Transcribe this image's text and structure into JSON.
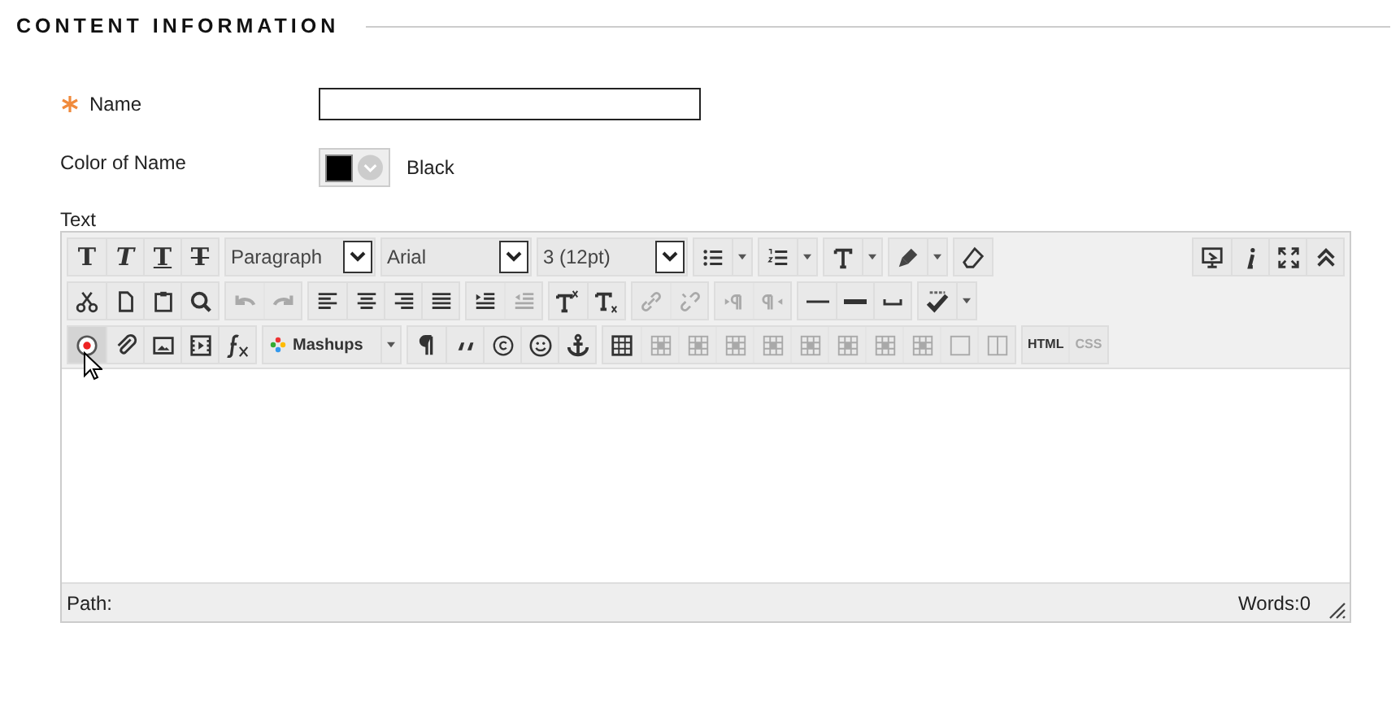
{
  "section": {
    "title": "CONTENT INFORMATION"
  },
  "fields": [
    {
      "kind": "text",
      "label": "Name",
      "required": true
    },
    {
      "kind": "color",
      "label": "Color of Name",
      "required": false,
      "color": "#000000",
      "value": "Black"
    }
  ],
  "editor": {
    "label": "Text",
    "toolbar": [
      [
        [
          {
            "kind": "bold",
            "label": "T",
            "disabled": false
          },
          {
            "kind": "italic",
            "label": "T",
            "disabled": false
          },
          {
            "kind": "underline",
            "label": "T",
            "disabled": false
          },
          {
            "kind": "strike",
            "label": "T",
            "disabled": false
          }
        ],
        [
          {
            "kind": "select",
            "value": "Paragraph"
          }
        ],
        [
          {
            "kind": "select",
            "value": "Arial"
          }
        ],
        [
          {
            "kind": "select",
            "value": "3 (12pt)"
          }
        ],
        [
          {
            "kind": "bullets",
            "split": true,
            "disabled": false
          }
        ],
        [
          {
            "kind": "numbers",
            "split": true,
            "disabled": false
          }
        ],
        [
          {
            "kind": "textcolor",
            "split": true,
            "disabled": false
          }
        ],
        [
          {
            "kind": "highlight",
            "split": true,
            "disabled": false
          }
        ],
        [
          {
            "kind": "eraser",
            "disabled": false
          }
        ],
        [
          {
            "kind": "spacer"
          }
        ],
        [
          {
            "kind": "preview",
            "disabled": false
          },
          {
            "kind": "info",
            "disabled": false
          },
          {
            "kind": "fullscreen",
            "disabled": false
          },
          {
            "kind": "collapse",
            "disabled": false
          }
        ]
      ],
      [
        [
          {
            "kind": "cut",
            "disabled": false
          },
          {
            "kind": "copy",
            "disabled": false
          },
          {
            "kind": "paste",
            "disabled": false
          },
          {
            "kind": "find",
            "disabled": false
          }
        ],
        [
          {
            "kind": "undo",
            "disabled": true
          },
          {
            "kind": "redo",
            "disabled": true
          }
        ],
        [
          {
            "kind": "alignleft",
            "disabled": false
          },
          {
            "kind": "aligncenter",
            "disabled": false
          },
          {
            "kind": "alignright",
            "disabled": false
          },
          {
            "kind": "justify",
            "disabled": false
          }
        ],
        [
          {
            "kind": "indent",
            "disabled": false
          },
          {
            "kind": "outdent",
            "disabled": true
          }
        ],
        [
          {
            "kind": "superscript",
            "disabled": false
          },
          {
            "kind": "subscript",
            "disabled": false
          }
        ],
        [
          {
            "kind": "link",
            "disabled": true
          },
          {
            "kind": "unlink",
            "disabled": true
          }
        ],
        [
          {
            "kind": "ltr",
            "disabled": true
          },
          {
            "kind": "rtl",
            "disabled": true
          }
        ],
        [
          {
            "kind": "hr",
            "disabled": false
          },
          {
            "kind": "thickline",
            "disabled": false
          },
          {
            "kind": "nbsp",
            "disabled": false
          }
        ],
        [
          {
            "kind": "spellcheck",
            "split": true,
            "disabled": false
          }
        ]
      ],
      [
        [
          {
            "kind": "record",
            "disabled": false,
            "hovered": true
          },
          {
            "kind": "attach",
            "disabled": false,
            "hovered": false
          },
          {
            "kind": "image",
            "disabled": false,
            "hovered": false
          },
          {
            "kind": "media",
            "disabled": false,
            "hovered": false
          },
          {
            "kind": "formula",
            "disabled": false,
            "hovered": false
          }
        ],
        [
          {
            "kind": "mashups",
            "label": "Mashups",
            "split": true,
            "disabled": false
          }
        ],
        [
          {
            "kind": "pilcrow",
            "disabled": false
          },
          {
            "kind": "quote",
            "disabled": false
          },
          {
            "kind": "copyright",
            "disabled": false
          },
          {
            "kind": "smiley",
            "disabled": false
          },
          {
            "kind": "anchor",
            "disabled": false
          }
        ],
        [
          {
            "kind": "table",
            "disabled": false
          },
          {
            "kind": "tablecell",
            "disabled": true
          },
          {
            "kind": "tablecell",
            "disabled": true
          },
          {
            "kind": "tablecell",
            "disabled": true
          },
          {
            "kind": "tablecell",
            "disabled": true
          },
          {
            "kind": "tablecell",
            "disabled": true
          },
          {
            "kind": "tablecell",
            "disabled": true
          },
          {
            "kind": "tablecell",
            "disabled": true
          },
          {
            "kind": "tablecell",
            "disabled": true
          },
          {
            "kind": "square",
            "disabled": true
          },
          {
            "kind": "columns",
            "disabled": true
          }
        ],
        [
          {
            "kind": "code",
            "label": "HTML",
            "disabled": false
          },
          {
            "kind": "code",
            "label": "CSS",
            "disabled": true
          }
        ]
      ]
    ],
    "status": {
      "path": "Path:",
      "words": "Words:0"
    }
  }
}
